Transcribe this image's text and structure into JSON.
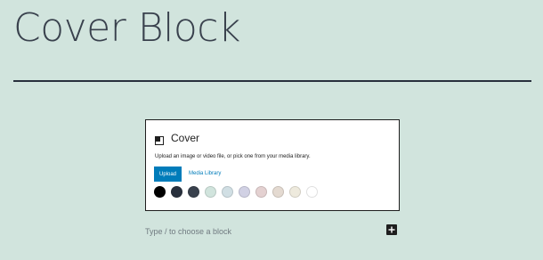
{
  "page": {
    "title": "Cover Block"
  },
  "cover": {
    "label": "Cover",
    "instructions": "Upload an image or video file, or pick one from your media library.",
    "upload_label": "Upload",
    "media_library_label": "Media Library",
    "swatches": [
      "#000000",
      "#28303d",
      "#39414d",
      "#d1e4dd",
      "#d1dfe4",
      "#d1d1e4",
      "#e4d1d1",
      "#e4dad1",
      "#eeeadd",
      "#ffffff"
    ]
  },
  "block": {
    "placeholder": "Type / to choose a block"
  }
}
